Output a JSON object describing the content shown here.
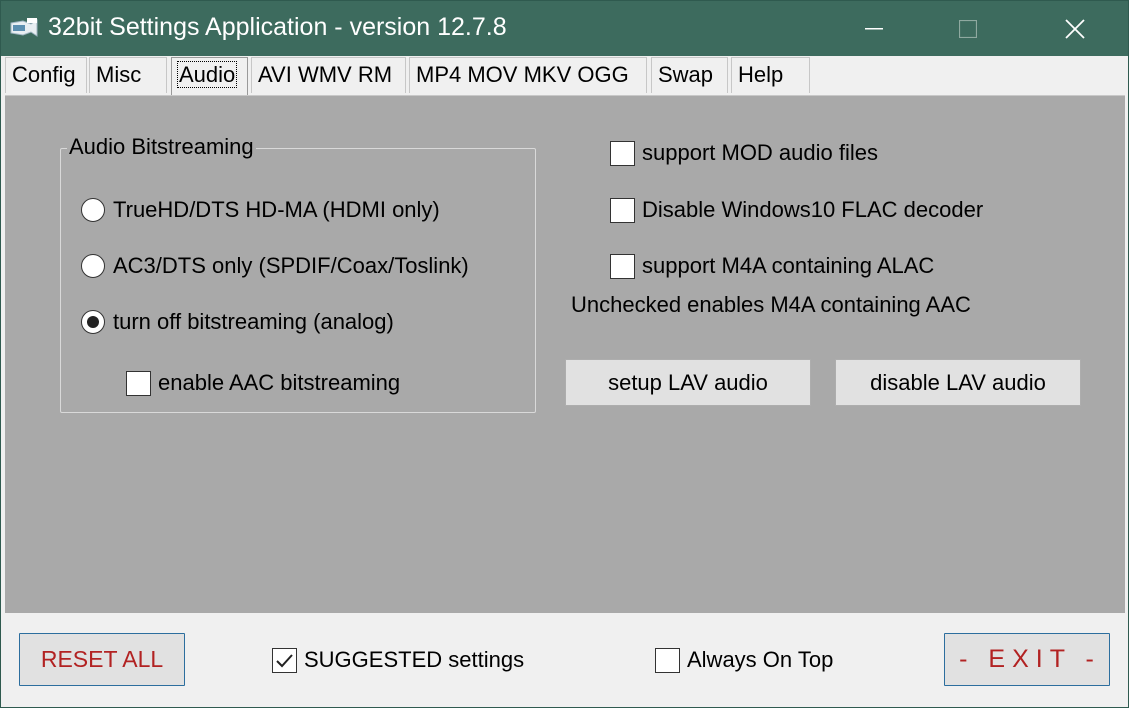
{
  "window": {
    "title": "32bit Settings Application - version 12.7.8"
  },
  "tabs": [
    {
      "label": "Config"
    },
    {
      "label": "Misc"
    },
    {
      "label": "Audio"
    },
    {
      "label": "AVI WMV RM"
    },
    {
      "label": "MP4 MOV MKV OGG"
    },
    {
      "label": "Swap"
    },
    {
      "label": "Help"
    }
  ],
  "active_tab": "Audio",
  "audio": {
    "bitstreaming_group": {
      "title": "Audio Bitstreaming",
      "options": [
        {
          "label": "TrueHD/DTS HD-MA (HDMI only)",
          "selected": false
        },
        {
          "label": "AC3/DTS only (SPDIF/Coax/Toslink)",
          "selected": false
        },
        {
          "label": "turn off bitstreaming (analog)",
          "selected": true
        }
      ],
      "aac_checkbox": {
        "label": "enable AAC bitstreaming",
        "checked": false
      }
    },
    "checkboxes": [
      {
        "label": "support MOD audio files",
        "checked": false
      },
      {
        "label": "Disable Windows10 FLAC decoder",
        "checked": false
      },
      {
        "label": "support M4A containing ALAC",
        "checked": false
      }
    ],
    "note": "Unchecked enables M4A containing AAC",
    "buttons": {
      "setup_lav": "setup LAV audio",
      "disable_lav": "disable LAV audio"
    }
  },
  "footer": {
    "reset_label": "RESET ALL",
    "suggested": {
      "label": "SUGGESTED settings",
      "checked": true
    },
    "always_on_top": {
      "label": "Always On Top",
      "checked": false
    },
    "exit_label": "- EXIT -"
  },
  "colors": {
    "titlebar": "#3d6b5e",
    "panel": "#a9a9a9",
    "accent_red": "#b22222"
  }
}
